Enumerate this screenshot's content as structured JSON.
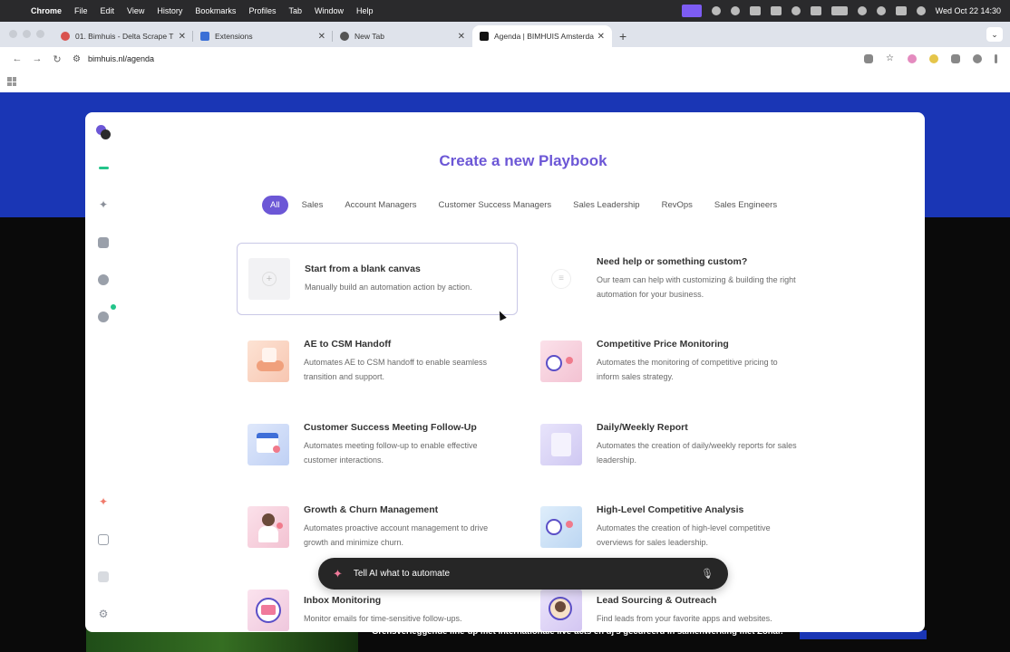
{
  "menubar": {
    "app": "Chrome",
    "items": [
      "File",
      "Edit",
      "View",
      "History",
      "Bookmarks",
      "Profiles",
      "Tab",
      "Window",
      "Help"
    ],
    "datetime": "Wed Oct 22  14:30"
  },
  "tabs": [
    {
      "title": "01. Bimhuis - Delta Scrape T",
      "active": false,
      "favicon_color": "#d9534f"
    },
    {
      "title": "Extensions",
      "active": false,
      "favicon_color": "#3b6fd6"
    },
    {
      "title": "New Tab",
      "active": false,
      "favicon_color": "#555555"
    },
    {
      "title": "Agenda | BIMHUIS Amsterdam",
      "active": true,
      "favicon_color": "#111111"
    }
  ],
  "toolbar": {
    "url": "bimhuis.nl/agenda"
  },
  "background_page": {
    "footer_text": "Grensverleggende line-up met internationale live-acts en dj's gecureerd in samenwerking met Zohar."
  },
  "modal": {
    "title": "Create a new Playbook",
    "filters": [
      {
        "label": "All",
        "active": true
      },
      {
        "label": "Sales",
        "active": false
      },
      {
        "label": "Account Managers",
        "active": false
      },
      {
        "label": "Customer Success Managers",
        "active": false
      },
      {
        "label": "Sales Leadership",
        "active": false
      },
      {
        "label": "RevOps",
        "active": false
      },
      {
        "label": "Sales Engineers",
        "active": false
      }
    ],
    "cards": [
      {
        "title": "Start from a blank canvas",
        "desc": "Manually build an automation action by action.",
        "icon": "plus-icon",
        "color": "#f2f2f4"
      },
      {
        "title": "Need help or something custom?",
        "desc": "Our team can help with customizing & building the right automation for your business.",
        "icon": "list-icon",
        "color": "#ffffff"
      },
      {
        "title": "AE to CSM Handoff",
        "desc": "Automates AE to CSM handoff to enable seamless transition and support.",
        "icon": "handoff-icon",
        "color": "#fbd9c9"
      },
      {
        "title": "Competitive Price Monitoring",
        "desc": "Automates the monitoring of competitive pricing to inform sales strategy.",
        "icon": "price-icon",
        "color": "#f8cfdc"
      },
      {
        "title": "Customer Success Meeting Follow-Up",
        "desc": "Automates meeting follow-up to enable effective customer interactions.",
        "icon": "calendar-icon",
        "color": "#cfdcf8"
      },
      {
        "title": "Daily/Weekly Report",
        "desc": "Automates the creation of daily/weekly reports for sales leadership.",
        "icon": "report-icon",
        "color": "#dcd8f6"
      },
      {
        "title": "Growth & Churn Management",
        "desc": "Automates proactive account management to drive growth and minimize churn.",
        "icon": "person-icon",
        "color": "#f8cfdc"
      },
      {
        "title": "High-Level Competitive Analysis",
        "desc": "Automates the creation of high-level competitive overviews for sales leadership.",
        "icon": "analysis-icon",
        "color": "#cfe2f8"
      },
      {
        "title": "Inbox Monitoring",
        "desc": "Monitor emails for time-sensitive follow-ups.",
        "icon": "mail-icon",
        "color": "#f6d6e6"
      },
      {
        "title": "Lead Sourcing & Outreach",
        "desc": "Find leads from your favorite apps and websites.",
        "icon": "lead-icon",
        "color": "#e0d6f8"
      }
    ],
    "ai_bar": {
      "placeholder": "Tell AI what to automate"
    }
  }
}
